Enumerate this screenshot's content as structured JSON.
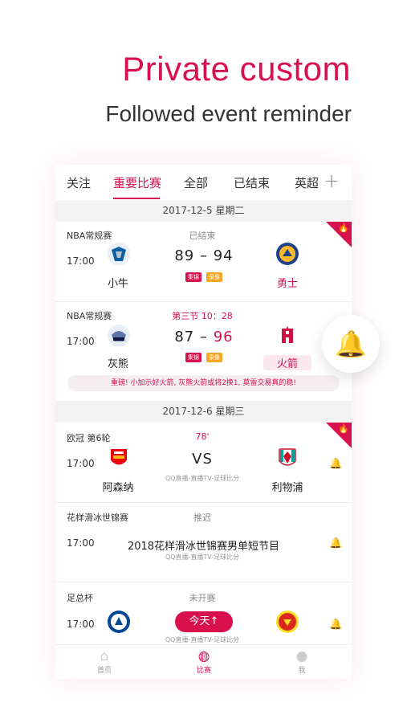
{
  "hero": {
    "title": "Private custom",
    "subtitle": "Followed event reminder"
  },
  "tabs": [
    "关注",
    "重要比赛",
    "全部",
    "已结束",
    "英超"
  ],
  "dates": [
    "2017-12-5 星期二",
    "2017-12-6 星期三"
  ],
  "matches": [
    {
      "league": "NBA常规赛",
      "time": "17:00",
      "status": "已结束",
      "home_score": "89",
      "away_score": "94",
      "home": "小牛",
      "away": "勇士",
      "tags": [
        "集锦",
        "录像"
      ]
    },
    {
      "league": "NBA常规赛",
      "time": "17:00",
      "status": "第三节 10：28",
      "home_score": "87",
      "away_score": "96",
      "home": "灰熊",
      "away": "火箭",
      "tags": [
        "集锦",
        "录像"
      ]
    },
    {
      "league": "欧冠 第6轮",
      "time": "17:00",
      "status": "78'",
      "vs": "VS",
      "home": "阿森纳",
      "away": "利物浦",
      "broadcast": "QQ直播-直播TV-足球比分"
    },
    {
      "league": "花样滑冰世锦赛",
      "time": "17:00",
      "status": "推迟",
      "event": "2018花样滑冰世锦赛男单短节目",
      "broadcast": "QQ直播-直播TV-足球比分"
    },
    {
      "league": "足总杯",
      "time": "17:00",
      "status": "未开赛",
      "button": "今天↑",
      "broadcast": "QQ直播-直播TV-足球比分"
    }
  ],
  "notice": "重磅! 小加示好火箭, 灰熊火箭或将2换1, 莫雷交易真的稳!",
  "nav": [
    "首页",
    "比赛",
    "我"
  ],
  "colors": {
    "accent": "#d8114e"
  }
}
